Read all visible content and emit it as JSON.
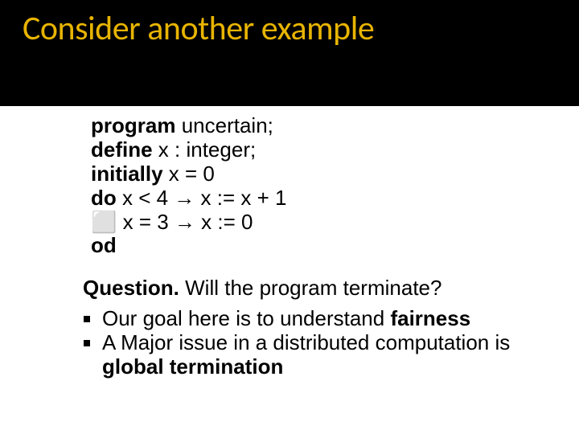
{
  "title": "Consider another example",
  "code": {
    "l1_kw": "program",
    "l1_rest": "    uncertain;",
    "l2_kw": "define",
    "l2_rest": "        x   :     integer;",
    "l3_kw": "initially",
    "l3_rest": "      x = 0",
    "l4_kw": "do",
    "l4_rest": "      x < 4 → x  := x + 1",
    "l5_sym": "⬜",
    "l5_rest": "       x = 3   →   x  := 0",
    "l6_kw": "od"
  },
  "question": {
    "label": "Question.",
    "text": " Will the program terminate?"
  },
  "bullets": {
    "b1_pre": "Our goal here is to understand ",
    "b1_bold": "fairness",
    "b2_pre": "A Major issue in a distributed computation is ",
    "b2_bold": "global termination"
  }
}
